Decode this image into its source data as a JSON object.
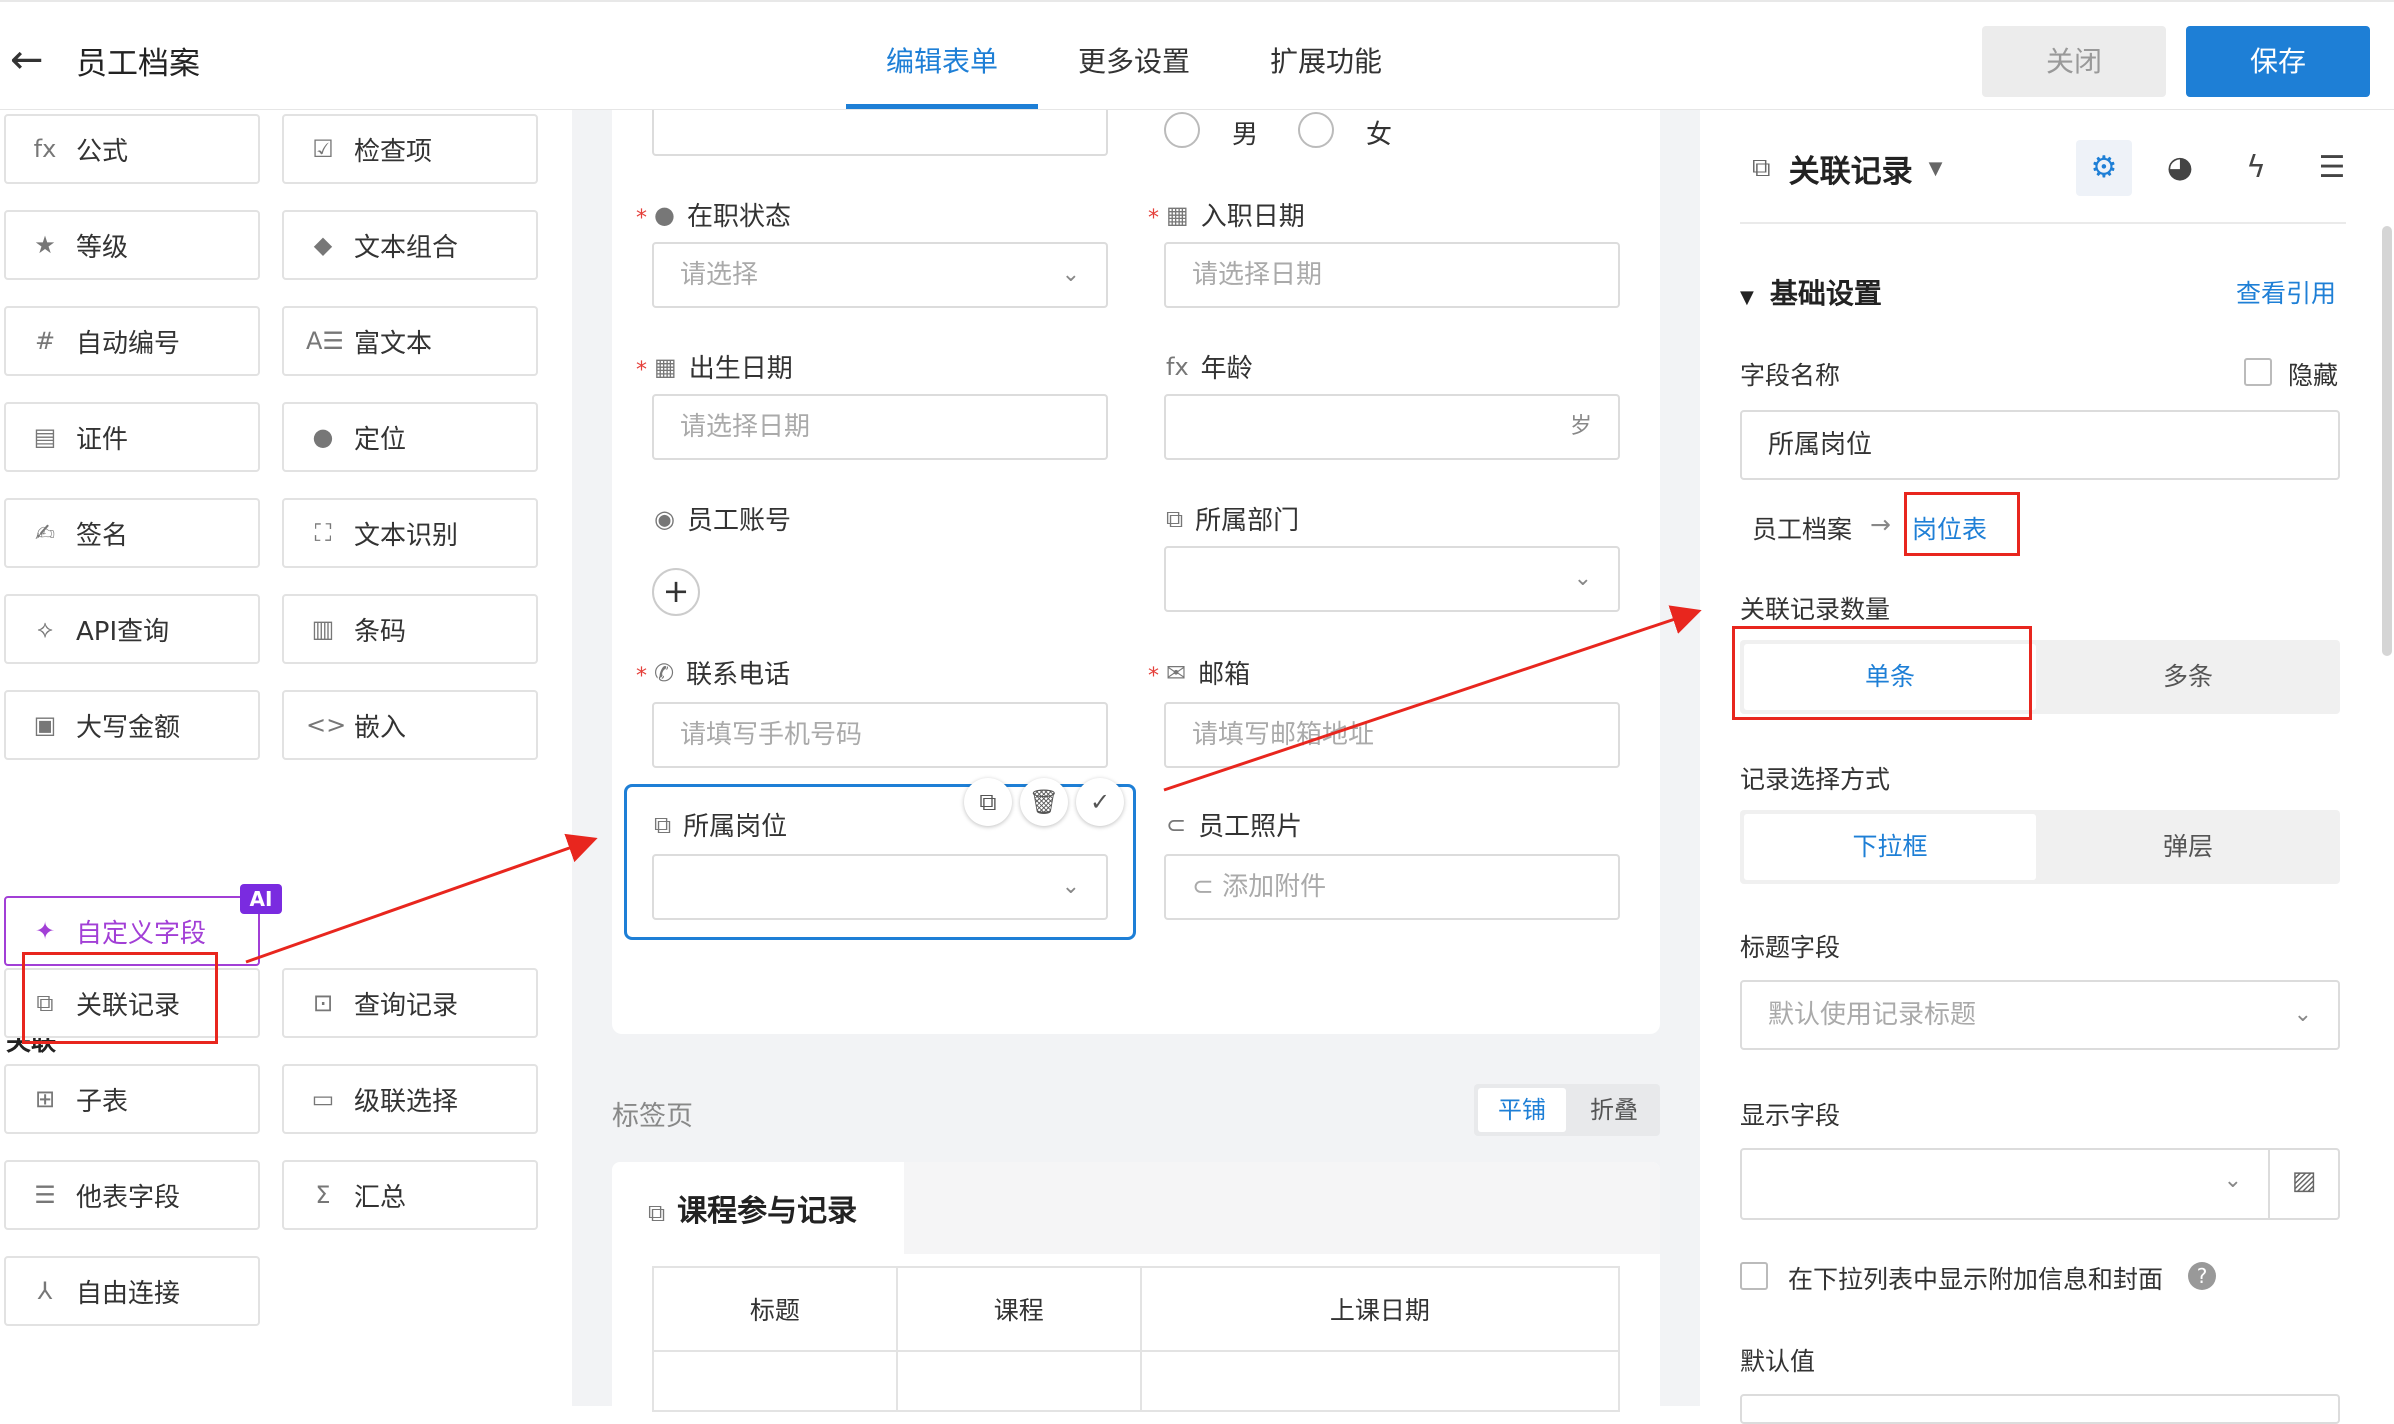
{
  "header": {
    "title": "员工档案",
    "tabs": [
      "编辑表单",
      "更多设置",
      "扩展功能"
    ],
    "close_label": "关闭",
    "save_label": "保存"
  },
  "left_panel": {
    "widgets": [
      {
        "icon": "formula-icon",
        "glyph": "fx",
        "label": "公式"
      },
      {
        "icon": "checkbox-icon",
        "glyph": "☑",
        "label": "检查项"
      },
      {
        "icon": "star-icon",
        "glyph": "★",
        "label": "等级"
      },
      {
        "icon": "shapes-icon",
        "glyph": "◆",
        "label": "文本组合"
      },
      {
        "icon": "hash-icon",
        "glyph": "#",
        "label": "自动编号"
      },
      {
        "icon": "rich-text-icon",
        "glyph": "A☰",
        "label": "富文本"
      },
      {
        "icon": "id-card-icon",
        "glyph": "▤",
        "label": "证件"
      },
      {
        "icon": "location-pin-icon",
        "glyph": "●",
        "label": "定位"
      },
      {
        "icon": "signature-icon",
        "glyph": "✍",
        "label": "签名"
      },
      {
        "icon": "ocr-icon",
        "glyph": "⛶",
        "label": "文本识别"
      },
      {
        "icon": "api-icon",
        "glyph": "⟡",
        "label": "API查询"
      },
      {
        "icon": "barcode-icon",
        "glyph": "▥",
        "label": "条码"
      },
      {
        "icon": "amount-icon",
        "glyph": "▣",
        "label": "大写金额"
      },
      {
        "icon": "embed-icon",
        "glyph": "<>",
        "label": "嵌入"
      }
    ],
    "custom_field": {
      "label": "自定义字段",
      "glyph": "✦",
      "badge": "AI"
    },
    "section_title": "关联",
    "relation_widgets": [
      {
        "icon": "link-record-icon",
        "glyph": "⧉",
        "label": "关联记录"
      },
      {
        "icon": "query-record-icon",
        "glyph": "⊡",
        "label": "查询记录"
      },
      {
        "icon": "subtable-icon",
        "glyph": "⊞",
        "label": "子表"
      },
      {
        "icon": "cascade-icon",
        "glyph": "▭",
        "label": "级联选择"
      },
      {
        "icon": "other-field-icon",
        "glyph": "☰",
        "label": "他表字段"
      },
      {
        "icon": "sum-icon",
        "glyph": "Σ",
        "label": "汇总"
      },
      {
        "icon": "connect-icon",
        "glyph": "⅄",
        "label": "自由连接"
      }
    ]
  },
  "form": {
    "gender_options": [
      "男",
      "女"
    ],
    "status": {
      "label": "在职状态",
      "placeholder": "请选择"
    },
    "hire_date": {
      "label": "入职日期",
      "placeholder": "请选择日期"
    },
    "birth_date": {
      "label": "出生日期",
      "placeholder": "请选择日期"
    },
    "age": {
      "label": "年龄",
      "icon_text": "fx",
      "suffix": "岁"
    },
    "account": {
      "label": "员工账号",
      "add": "+"
    },
    "department": {
      "label": "所属部门"
    },
    "phone": {
      "label": "联系电话",
      "placeholder": "请填写手机号码"
    },
    "email": {
      "label": "邮箱",
      "placeholder": "请填写邮箱地址"
    },
    "position": {
      "label": "所属岗位"
    },
    "photo": {
      "label": "员工照片",
      "placeholder": "添加附件"
    },
    "tabs_label": "标签页",
    "tab_mode": {
      "on": "平铺",
      "off": "折叠"
    },
    "subtab": {
      "title": "课程参与记录",
      "columns": [
        "标题",
        "课程",
        "上课日期"
      ]
    }
  },
  "right_panel": {
    "title": "关联记录",
    "basic_settings": "基础设置",
    "view_refs": "查看引用",
    "field_name_label": "字段名称",
    "hide_label": "隐藏",
    "field_name_value": "所属岗位",
    "relation_from": "员工档案",
    "relation_arrow": "→",
    "relation_to": "岗位表",
    "count_label": "关联记录数量",
    "count_options": {
      "on": "单条",
      "off": "多条"
    },
    "select_mode_label": "记录选择方式",
    "select_mode_options": {
      "on": "下拉框",
      "off": "弹层"
    },
    "title_field_label": "标题字段",
    "title_field_placeholder": "默认使用记录标题",
    "display_field_label": "显示字段",
    "extra_info_label": "在下拉列表中显示附加信息和封面",
    "default_label": "默认值"
  },
  "colors": {
    "accent": "#1e7fd6",
    "required": "#e5403b",
    "annotation": "#e8261e",
    "ai": "#a23fd6"
  }
}
